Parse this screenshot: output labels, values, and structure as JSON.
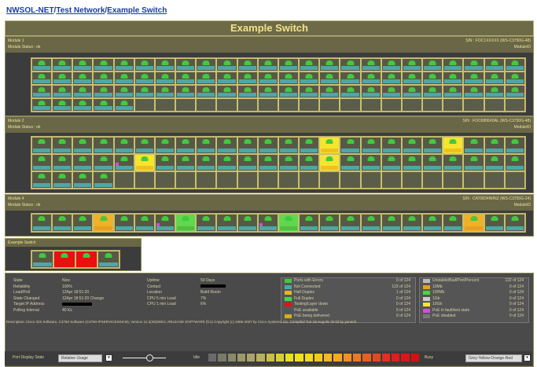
{
  "breadcrumb": {
    "part1": "NWSOL-NET",
    "sep1": "/",
    "part2": "Test Network",
    "sep2": "/",
    "part3": "Example Switch"
  },
  "title": "Example Switch",
  "modules": [
    {
      "name": "Module 1",
      "status": "Module Status : ok",
      "serial": "S/N : FOC1XXXXX (WS-C3750G-48)",
      "model": "ModuleID"
    },
    {
      "name": "Module 2",
      "status": "Module Status : ok",
      "serial": "S/N : FOC0806X0AL (WS-C3750G-48)",
      "model": "ModuleID"
    },
    {
      "name": "Module 4",
      "status": "Module Status : ok",
      "serial": "S/N : CAT0834N0NZ (WS-C3750G-24)",
      "model": "ModuleID"
    },
    {
      "name": "Example Switch",
      "status": "",
      "serial": "",
      "model": ""
    }
  ],
  "status_left": {
    "labels": [
      "State",
      "Reliability",
      "Load/Poll",
      "State Changed",
      "Target IP Address",
      "Polling Interval"
    ],
    "values": [
      "Nice",
      "100%",
      "12Apr 18:51:20",
      "12Apr 18:51:20 Change",
      "",
      "40 Ks"
    ]
  },
  "status_mid": {
    "labels": [
      "Uptime",
      "Contact",
      "Location",
      "CPU 5 min Load",
      "CPU 1 min Load"
    ],
    "values": [
      "59 Days",
      "",
      "Build Room",
      "7%",
      "6%"
    ]
  },
  "legend1": [
    {
      "label": "Ports with Errors",
      "count": "0 of 124",
      "color": "#3ecb3a"
    },
    {
      "label": "Not Connected",
      "count": "122 of 124",
      "color": "#4fa6a6"
    },
    {
      "label": "Half Duplex",
      "count": "1 of 124",
      "color": "#efb22a"
    },
    {
      "label": "Full Duplex",
      "count": "0 of 124",
      "color": "#44d844"
    },
    {
      "label": "Testing/Layer down",
      "count": "0 of 124",
      "color": "#e81010"
    },
    {
      "label": "PoE available",
      "count": "0 of 124",
      "color": "#555555"
    },
    {
      "label": "PoE being delivered",
      "count": "0 of 124",
      "color": "#d0b020"
    }
  ],
  "legend2": [
    {
      "label": "Unstable/Bad/Port/Percent",
      "count": "122 of 124",
      "color": "#bbbbbb"
    },
    {
      "label": "10Mb",
      "count": "0 of 124",
      "color": "#e8a020"
    },
    {
      "label": "100Mb",
      "count": "0 of 124",
      "color": "#44d844"
    },
    {
      "label": "1Gb",
      "count": "0 of 124",
      "color": "#cccccc"
    },
    {
      "label": "10Gb",
      "count": "0 of 124",
      "color": "#f5e52e"
    },
    {
      "label": "PoE in fault/test state",
      "count": "0 of 124",
      "color": "#d050d0"
    },
    {
      "label": "PoE disabled",
      "count": "0 of 124",
      "color": "#777777"
    }
  ],
  "description": "Description: Cisco IOS Software, C3750 Software (C3750-IPSERVICESK9-M), Version 12.2(25)SEE4, RELEASE SOFTWARE (fc1) Copyright (c) 1986-2007 by Cisco Systems, Inc. Compiled Tue 18-Aug-05 19:33 by yenanh",
  "bottom": {
    "port_display_label": "Port Display State",
    "select_value": "Relative Usage",
    "scale_label": "Idle",
    "busy_label": "Busy",
    "mode_value": "Grey-Yellow-Orange-Red"
  }
}
